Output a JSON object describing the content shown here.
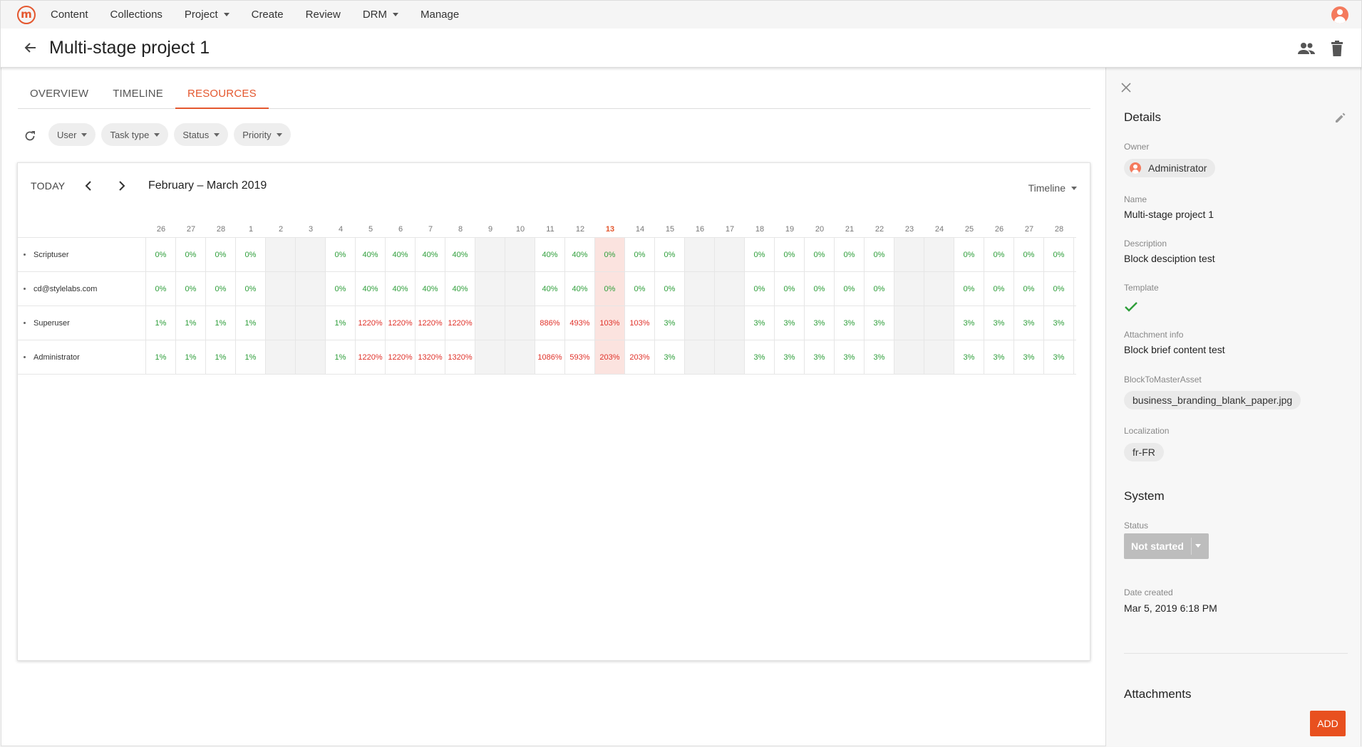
{
  "nav": {
    "logo_letter": "m",
    "items": [
      {
        "label": "Content",
        "dropdown": false
      },
      {
        "label": "Collections",
        "dropdown": false
      },
      {
        "label": "Project",
        "dropdown": true
      },
      {
        "label": "Create",
        "dropdown": false
      },
      {
        "label": "Review",
        "dropdown": false
      },
      {
        "label": "DRM",
        "dropdown": true
      },
      {
        "label": "Manage",
        "dropdown": false
      }
    ]
  },
  "header": {
    "title": "Multi-stage project 1"
  },
  "tabs": [
    {
      "label": "OVERVIEW",
      "active": false
    },
    {
      "label": "TIMELINE",
      "active": false
    },
    {
      "label": "RESOURCES",
      "active": true
    }
  ],
  "filters": [
    "User",
    "Task type",
    "Status",
    "Priority"
  ],
  "schedule": {
    "today_label": "TODAY",
    "period": "February – March 2019",
    "view": "Timeline",
    "days": [
      "26",
      "27",
      "28",
      "1",
      "2",
      "3",
      "4",
      "5",
      "6",
      "7",
      "8",
      "9",
      "10",
      "11",
      "12",
      "13",
      "14",
      "15",
      "16",
      "17",
      "18",
      "19",
      "20",
      "21",
      "22",
      "23",
      "24",
      "25",
      "26",
      "27",
      "28"
    ],
    "today_index": 15,
    "weekend_indices": [
      4,
      5,
      11,
      12,
      18,
      19,
      25,
      26
    ],
    "rows": [
      {
        "name": "Scriptuser",
        "values": [
          "0%",
          "0%",
          "0%",
          "0%",
          "",
          "",
          "0%",
          "40%",
          "40%",
          "40%",
          "40%",
          "",
          "",
          "40%",
          "40%",
          "0%",
          "0%",
          "0%",
          "",
          "",
          "0%",
          "0%",
          "0%",
          "0%",
          "0%",
          "",
          "",
          "0%",
          "0%",
          "0%",
          "0%"
        ]
      },
      {
        "name": "cd@stylelabs.com",
        "values": [
          "0%",
          "0%",
          "0%",
          "0%",
          "",
          "",
          "0%",
          "40%",
          "40%",
          "40%",
          "40%",
          "",
          "",
          "40%",
          "40%",
          "0%",
          "0%",
          "0%",
          "",
          "",
          "0%",
          "0%",
          "0%",
          "0%",
          "0%",
          "",
          "",
          "0%",
          "0%",
          "0%",
          "0%"
        ]
      },
      {
        "name": "Superuser",
        "values": [
          "1%",
          "1%",
          "1%",
          "1%",
          "",
          "",
          "1%",
          "1220%",
          "1220%",
          "1220%",
          "1220%",
          "",
          "",
          "886%",
          "493%",
          "103%",
          "103%",
          "3%",
          "",
          "",
          "3%",
          "3%",
          "3%",
          "3%",
          "3%",
          "",
          "",
          "3%",
          "3%",
          "3%",
          "3%"
        ]
      },
      {
        "name": "Administrator",
        "values": [
          "1%",
          "1%",
          "1%",
          "1%",
          "",
          "",
          "1%",
          "1220%",
          "1220%",
          "1320%",
          "1320%",
          "",
          "",
          "1086%",
          "593%",
          "203%",
          "203%",
          "3%",
          "",
          "",
          "3%",
          "3%",
          "3%",
          "3%",
          "3%",
          "",
          "",
          "3%",
          "3%",
          "3%",
          "3%"
        ]
      }
    ]
  },
  "details": {
    "title": "Details",
    "owner_label": "Owner",
    "owner": "Administrator",
    "name_label": "Name",
    "name": "Multi-stage project 1",
    "description_label": "Description",
    "description": "Block desciption test",
    "template_label": "Template",
    "attachment_info_label": "Attachment info",
    "attachment_info": "Block brief content test",
    "block_asset_label": "BlockToMasterAsset",
    "block_asset": "business_branding_blank_paper.jpg",
    "localization_label": "Localization",
    "localization": "fr-FR"
  },
  "system": {
    "title": "System",
    "status_label": "Status",
    "status": "Not started",
    "date_created_label": "Date created",
    "date_created": "Mar 5, 2019 6:18 PM"
  },
  "attachments": {
    "title": "Attachments",
    "add_label": "ADD"
  },
  "colors": {
    "accent": "#e4572e",
    "ok": "#2e9e3a",
    "over": "#e0322a",
    "add_button": "#e8501f"
  }
}
